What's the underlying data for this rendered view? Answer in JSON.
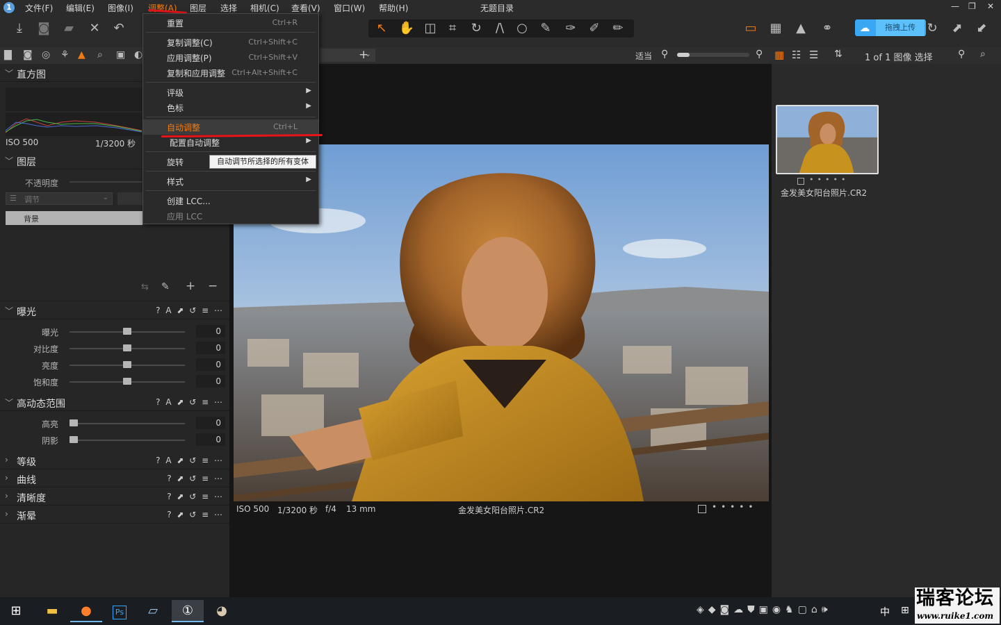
{
  "app": {
    "title": "无题目录",
    "window_controls": [
      "—",
      "❐",
      "✕"
    ]
  },
  "menubar": {
    "items": [
      "文件(F)",
      "编辑(E)",
      "图像(I)",
      "调整(A)",
      "图层",
      "选择",
      "相机(C)",
      "查看(V)",
      "窗口(W)",
      "帮助(H)"
    ]
  },
  "adjust_menu": {
    "items": [
      {
        "label": "重置",
        "shortcut": "Ctrl+R"
      },
      {
        "label": "复制调整(C)",
        "shortcut": "Ctrl+Shift+C"
      },
      {
        "label": "应用调整(P)",
        "shortcut": "Ctrl+Shift+V"
      },
      {
        "label": "复制和应用调整",
        "shortcut": "Ctrl+Alt+Shift+C"
      },
      {
        "label": "评级",
        "shortcut": ""
      },
      {
        "label": "色标",
        "shortcut": ""
      },
      {
        "label": "自动调整",
        "shortcut": "Ctrl+L"
      },
      {
        "label": "配置自动调整",
        "shortcut": ""
      },
      {
        "label": "旋转",
        "shortcut": ""
      },
      {
        "label": "样式",
        "shortcut": ""
      },
      {
        "label": "创建 LCC...",
        "shortcut": ""
      },
      {
        "label": "应用 LCC",
        "shortcut": ""
      }
    ],
    "tooltip": "自动调节所选择的所有变体"
  },
  "toolbar": {
    "upload_label": "拖拽上传",
    "accent": "#f07a12"
  },
  "histogram": {
    "title": "直方图",
    "iso": "ISO 500",
    "shutter": "1/3200 秒"
  },
  "layers": {
    "title": "图层",
    "opacity_label": "不透明度",
    "adjust_label": "调节",
    "background_label": "背景"
  },
  "exposure": {
    "title": "曝光",
    "sliders": [
      {
        "label": "曝光",
        "value": "0",
        "level": 0.5
      },
      {
        "label": "对比度",
        "value": "0",
        "level": 0.5
      },
      {
        "label": "亮度",
        "value": "0",
        "level": 0.5
      },
      {
        "label": "饱和度",
        "value": "0",
        "level": 0.5
      }
    ]
  },
  "hdr": {
    "title": "高动态范围",
    "sliders": [
      {
        "label": "高亮",
        "value": "0",
        "level": 0.0
      },
      {
        "label": "阴影",
        "value": "0",
        "level": 0.0
      }
    ]
  },
  "collapsed_sections": [
    "等级",
    "曲线",
    "清晰度",
    "渐晕"
  ],
  "viewer": {
    "fit_label": "适当",
    "info": {
      "iso": "ISO 500",
      "shutter": "1/3200 秒",
      "aperture": "f/4",
      "focal": "13 mm"
    },
    "filename": "金发美女阳台照片.CR2"
  },
  "browser": {
    "count_label": "1 of 1 图像 选择",
    "thumb_name": "金发美女阳台照片.CR2"
  },
  "taskbar": {
    "ime": "中"
  },
  "watermark": {
    "line1": "瑞客论坛",
    "line2": "www.ruike1.com"
  }
}
